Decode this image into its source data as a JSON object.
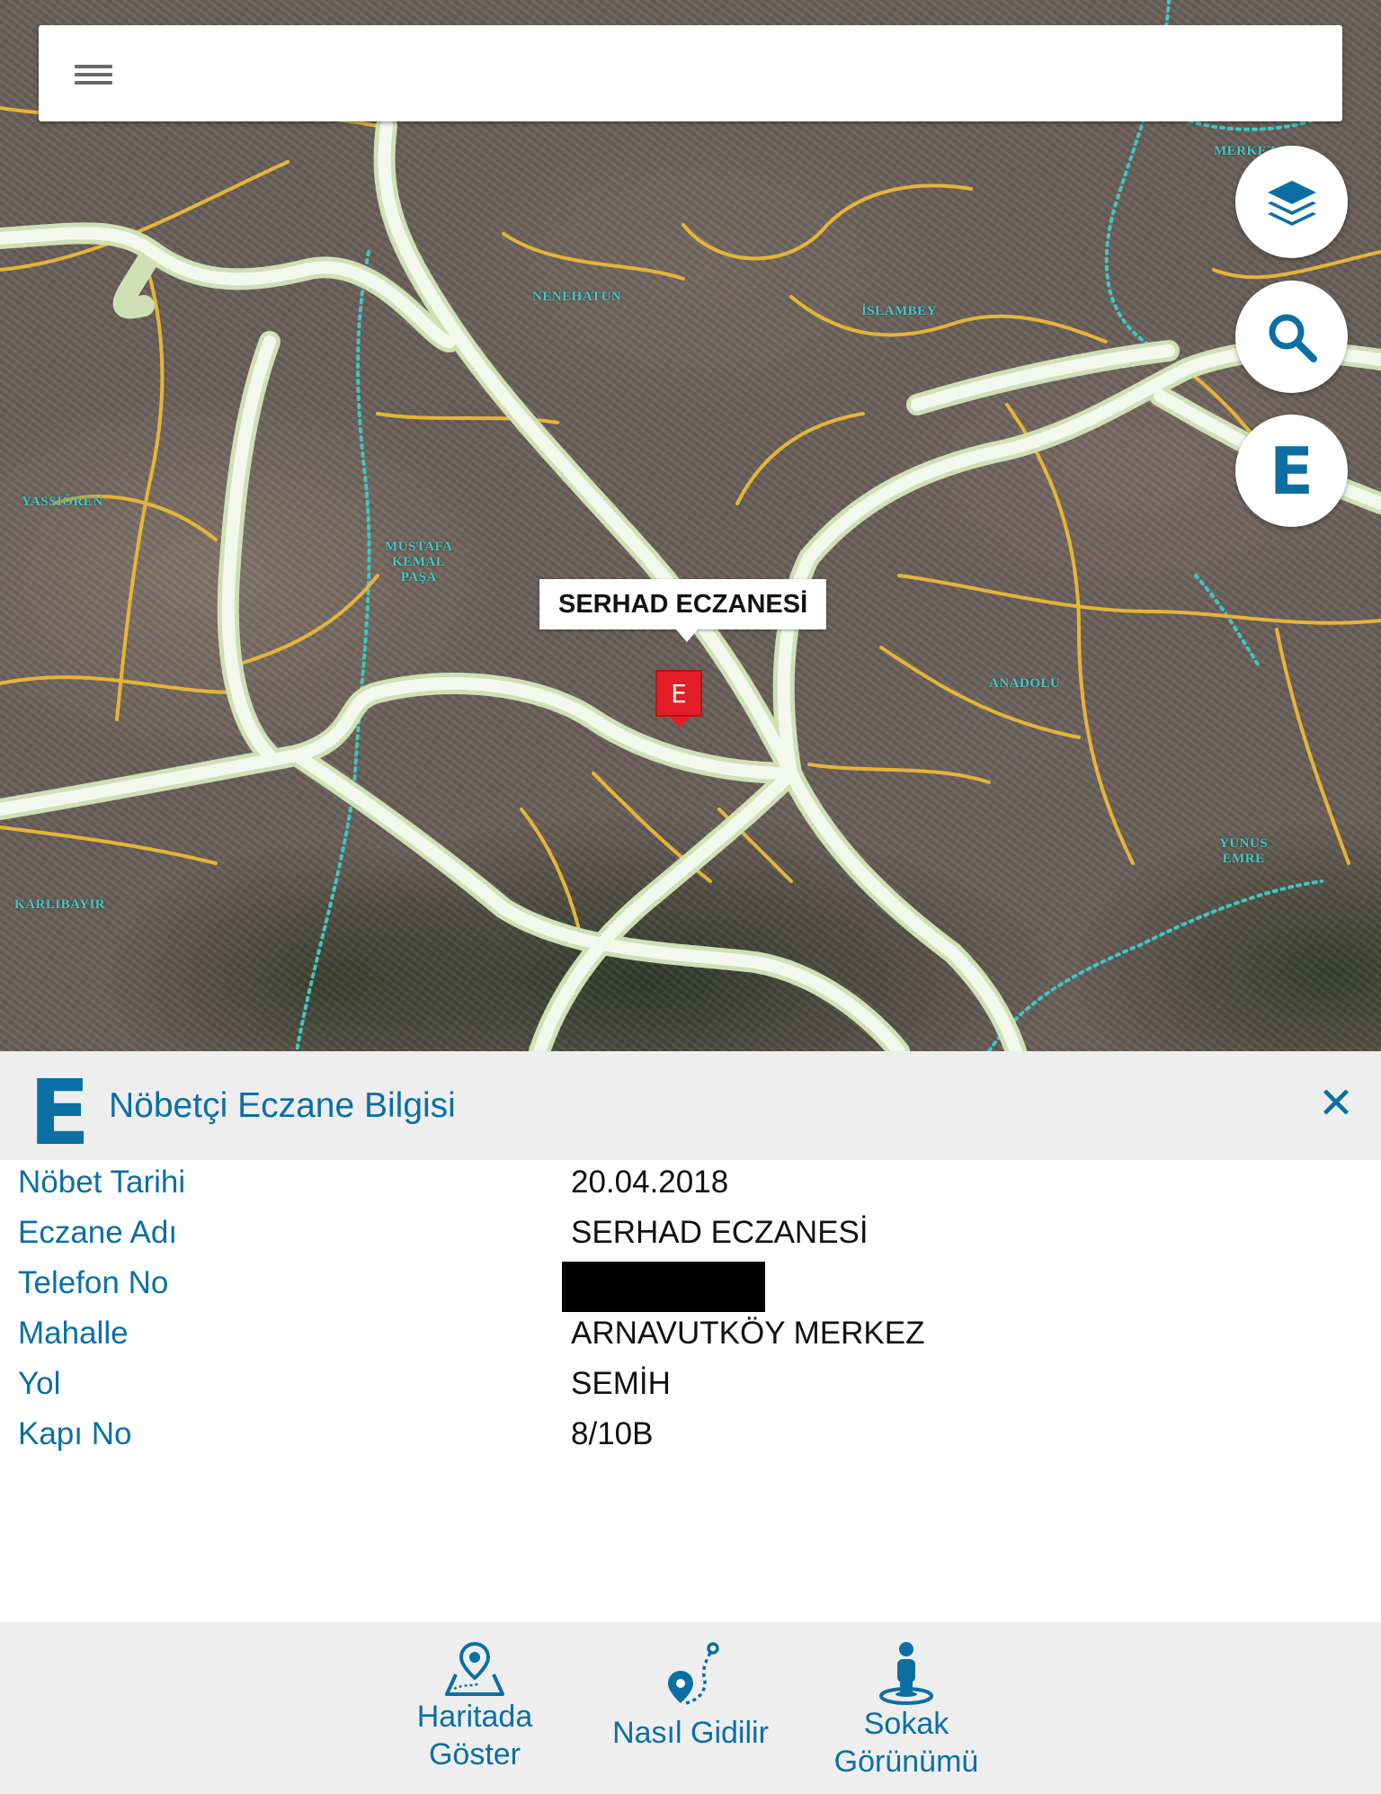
{
  "top_bar": {
    "menu_icon": "hamburger-menu-icon"
  },
  "map_controls": [
    {
      "name": "layers",
      "icon": "layers-icon"
    },
    {
      "name": "search",
      "icon": "search-icon"
    },
    {
      "name": "pharmacy",
      "icon": "pharmacy-e-icon",
      "glyph": "E"
    }
  ],
  "map": {
    "labels": {
      "nenehatun": "NENEHATUN",
      "islambey": "İSLAMBEY",
      "yassioren": "YASSIÖREN",
      "mkp": "MUSTAFA\nKEMAL\nPAŞA",
      "anadolu": "ANADOLU",
      "yunus": "YUNUS\nEMRE",
      "karlibayir": "KARLIBAYIR",
      "merkez": "MERKEZ"
    },
    "marker": {
      "glyph": "E",
      "color": "#e41e26"
    },
    "callout": "SERHAD ECZANESİ"
  },
  "panel": {
    "icon_glyph": "E",
    "title": "Nöbetçi Eczane Bilgisi",
    "close_glyph": "✕",
    "rows": [
      {
        "label": "Nöbet Tarihi",
        "value": "20.04.2018"
      },
      {
        "label": "Eczane Adı",
        "value": "SERHAD ECZANESİ"
      },
      {
        "label": "Telefon No",
        "value": ""
      },
      {
        "label": "Mahalle",
        "value": "ARNAVUTKÖY MERKEZ"
      },
      {
        "label": "Yol",
        "value": "SEMİH"
      },
      {
        "label": "Kapı No",
        "value": "8/10B"
      }
    ]
  },
  "actions": [
    {
      "label": "Haritada\nGöster",
      "icon": "map-pin-icon"
    },
    {
      "label": "Nasıl Gidilir",
      "icon": "route-icon"
    },
    {
      "label": "Sokak\nGörünümü",
      "icon": "street-view-person-icon"
    }
  ],
  "colors": {
    "accent": "#0b6fa4",
    "panel_bg": "#eeeeee",
    "marker": "#e41e26",
    "road_major": "#f4f8ec",
    "road_minor": "#e5b53a",
    "boundary": "#3fc7c5"
  }
}
